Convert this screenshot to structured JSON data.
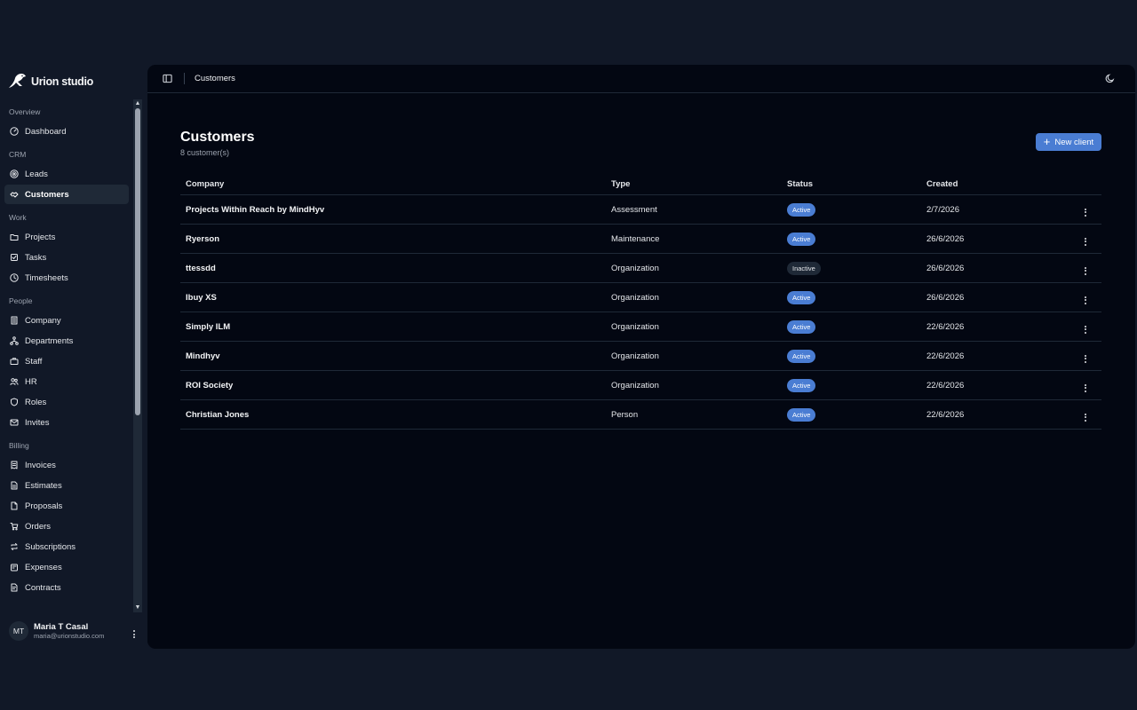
{
  "brand": {
    "name": "Urion studio"
  },
  "sidebar": {
    "groups": [
      {
        "label": "Overview",
        "items": [
          {
            "label": "Dashboard",
            "icon": "gauge-icon"
          }
        ]
      },
      {
        "label": "CRM",
        "items": [
          {
            "label": "Leads",
            "icon": "target-icon"
          },
          {
            "label": "Customers",
            "icon": "handshake-icon",
            "active": true
          }
        ]
      },
      {
        "label": "Work",
        "items": [
          {
            "label": "Projects",
            "icon": "folder-icon"
          },
          {
            "label": "Tasks",
            "icon": "tasks-icon"
          },
          {
            "label": "Timesheets",
            "icon": "clock-icon"
          }
        ]
      },
      {
        "label": "People",
        "items": [
          {
            "label": "Company",
            "icon": "building-icon"
          },
          {
            "label": "Departments",
            "icon": "network-icon"
          },
          {
            "label": "Staff",
            "icon": "briefcase-icon"
          },
          {
            "label": "HR",
            "icon": "users-icon"
          },
          {
            "label": "Roles",
            "icon": "shield-icon"
          },
          {
            "label": "Invites",
            "icon": "mail-icon"
          }
        ]
      },
      {
        "label": "Billing",
        "items": [
          {
            "label": "Invoices",
            "icon": "receipt-icon"
          },
          {
            "label": "Estimates",
            "icon": "file-icon"
          },
          {
            "label": "Proposals",
            "icon": "document-icon"
          },
          {
            "label": "Orders",
            "icon": "cart-icon"
          },
          {
            "label": "Subscriptions",
            "icon": "repeat-icon"
          },
          {
            "label": "Expenses",
            "icon": "wallet-icon"
          },
          {
            "label": "Contracts",
            "icon": "contract-icon"
          }
        ]
      }
    ]
  },
  "user": {
    "initials": "MT",
    "name": "Maria T Casal",
    "email": "maria@urionstudio.com"
  },
  "topbar": {
    "breadcrumb": "Customers"
  },
  "page": {
    "title": "Customers",
    "subtitle": "8 customer(s)",
    "new_button": "New client"
  },
  "table": {
    "columns": [
      "Company",
      "Type",
      "Status",
      "Created"
    ],
    "rows": [
      {
        "company": "Projects Within Reach by MindHyv",
        "type": "Assessment",
        "status": "Active",
        "created": "2/7/2026"
      },
      {
        "company": "Ryerson",
        "type": "Maintenance",
        "status": "Active",
        "created": "26/6/2026"
      },
      {
        "company": "ttessdd",
        "type": "Organization",
        "status": "Inactive",
        "created": "26/6/2026"
      },
      {
        "company": "Ibuy XS",
        "type": "Organization",
        "status": "Active",
        "created": "26/6/2026"
      },
      {
        "company": "Simply ILM",
        "type": "Organization",
        "status": "Active",
        "created": "22/6/2026"
      },
      {
        "company": "Mindhyv",
        "type": "Organization",
        "status": "Active",
        "created": "22/6/2026"
      },
      {
        "company": "ROI Society",
        "type": "Organization",
        "status": "Active",
        "created": "22/6/2026"
      },
      {
        "company": "Christian Jones",
        "type": "Person",
        "status": "Active",
        "created": "22/6/2026"
      }
    ]
  },
  "colors": {
    "accent": "#4a7dd3",
    "background": "#111827",
    "panel": "#030712"
  }
}
